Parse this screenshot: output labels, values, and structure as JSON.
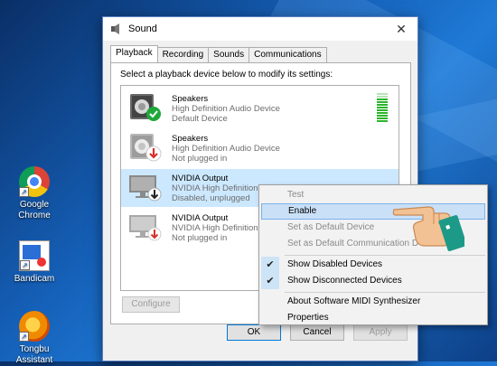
{
  "desktop": {
    "icons": [
      {
        "label_line1": "Google",
        "label_line2": "Chrome",
        "icon": "chrome-icon"
      },
      {
        "label_line1": "Bandicam",
        "label_line2": "",
        "icon": "bandicam-icon"
      },
      {
        "label_line1": "Tongbu",
        "label_line2": "Assistant",
        "icon": "tongbu-icon"
      }
    ]
  },
  "dialog": {
    "title": "Sound",
    "close_glyph": "✕",
    "tabs": [
      "Playback",
      "Recording",
      "Sounds",
      "Communications"
    ],
    "active_tab": "Playback",
    "instruction": "Select a playback device below to modify its settings:",
    "devices": [
      {
        "name": "Speakers",
        "driver": "High Definition Audio Device",
        "status": "Default Device",
        "badge": "default-check-icon",
        "meter_level": 0.85
      },
      {
        "name": "Speakers",
        "driver": "High Definition Audio Device",
        "status": "Not plugged in",
        "badge": "unplugged-arrow-icon"
      },
      {
        "name": "NVIDIA Output",
        "driver": "NVIDIA High Definition Audio",
        "status": "Disabled, unplugged",
        "badge": "disabled-arrow-icon",
        "selected": true
      },
      {
        "name": "NVIDIA Output",
        "driver": "NVIDIA High Definition Au",
        "status": "Not plugged in",
        "badge": "unplugged-arrow-icon"
      }
    ],
    "configure_label": "Configure",
    "ok_label": "OK",
    "cancel_label": "Cancel",
    "apply_label": "Apply"
  },
  "context_menu": {
    "items": [
      {
        "label": "Test",
        "disabled": true
      },
      {
        "label": "Enable",
        "highlighted": true
      },
      {
        "label": "Set as Default Device",
        "disabled": true
      },
      {
        "label": "Set as Default Communication D",
        "disabled": true
      },
      {
        "label": "Show Disabled Devices",
        "checked": true
      },
      {
        "label": "Show Disconnected Devices",
        "checked": true
      },
      {
        "label": "About Software MIDI Synthesizer"
      },
      {
        "label": "Properties"
      }
    ],
    "check_glyph": "✔"
  },
  "colors": {
    "accent": "#0078d7",
    "selection": "#cce8ff",
    "meter_green": "#2cb52c",
    "status_green": "#1fa83a",
    "status_red": "#d9302c"
  }
}
